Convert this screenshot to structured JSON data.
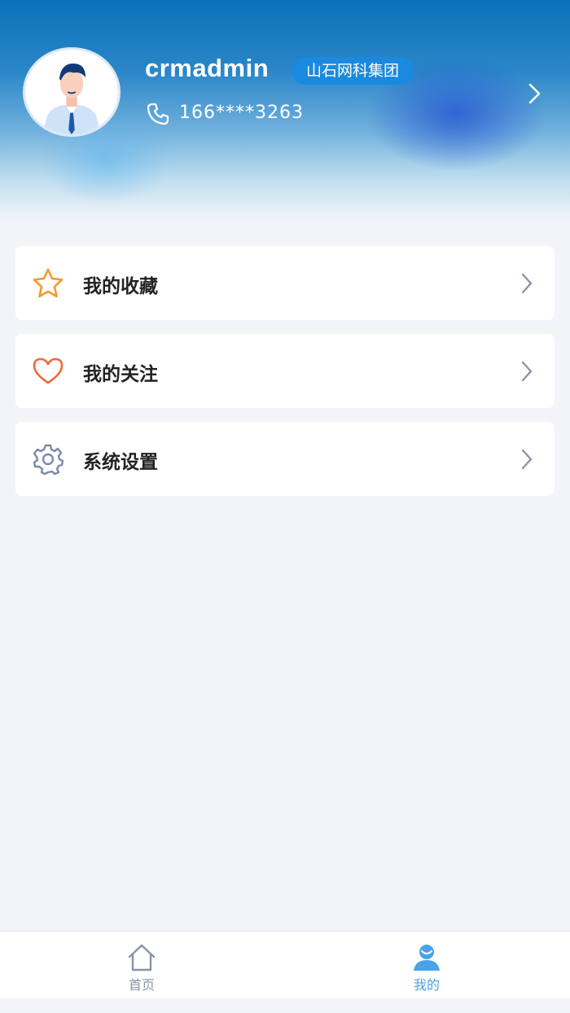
{
  "profile": {
    "username": "crmadmin",
    "organization": "山石网科集团",
    "phone": "166****3263"
  },
  "menu": [
    {
      "label": "我的收藏",
      "icon": "star-icon"
    },
    {
      "label": "我的关注",
      "icon": "heart-icon"
    },
    {
      "label": "系统设置",
      "icon": "gear-icon"
    }
  ],
  "tabbar": {
    "items": [
      {
        "label": "首页",
        "icon": "home-icon",
        "active": false
      },
      {
        "label": "我的",
        "icon": "user-icon",
        "active": true
      }
    ]
  },
  "colors": {
    "accent": "#1a8ae0",
    "tab_active": "#4aa3e6",
    "tab_inactive": "#8a93a8",
    "star": "#f39a2b",
    "heart": "#ef6a3a",
    "gear": "#7d8aa8"
  }
}
